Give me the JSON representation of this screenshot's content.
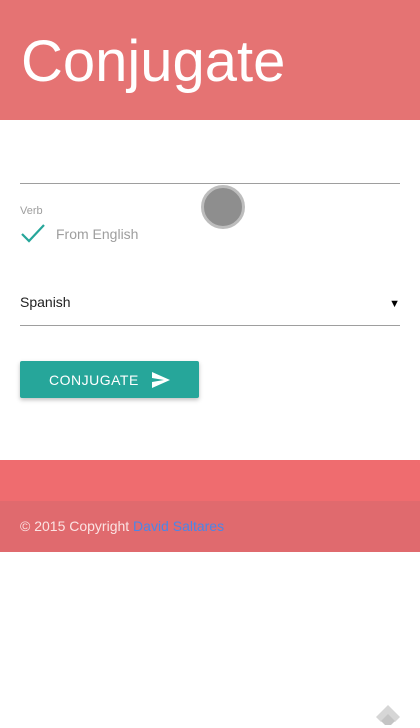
{
  "header": {
    "title": "Conjugate"
  },
  "form": {
    "verb_value": "",
    "verb_label": "Verb",
    "from_english_label": "From English",
    "from_english_checked": true,
    "language_selected": "Spanish",
    "caret": "▼",
    "submit_label": "CONJUGATE"
  },
  "footer": {
    "copyright_prefix": "© 2015 Copyright ",
    "author_link": "David Saltares"
  },
  "colors": {
    "header": "#e57373",
    "button": "#26a69a",
    "footer": "#ef6c6f",
    "footer_copy": "#e06a6e",
    "link": "#4a86e8"
  },
  "icons": {
    "check": "check-icon",
    "send": "send-icon",
    "watermark": "feedly-icon"
  }
}
